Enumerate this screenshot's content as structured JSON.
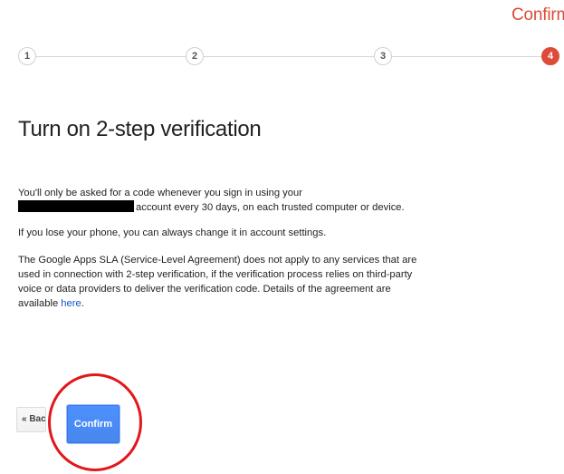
{
  "header": {
    "step_title": "Confirm"
  },
  "progress": {
    "steps": [
      "1",
      "2",
      "3",
      "4"
    ],
    "active_step": "4"
  },
  "main": {
    "heading": "Turn on 2-step verification",
    "paragraph_1_part_1": "You'll only be asked for a code whenever you sign in using your",
    "paragraph_1_part_2": "account every 30 days, on each trusted computer or device.",
    "paragraph_2": "If you lose your phone, you can always change it in account settings.",
    "paragraph_3_text": "The Google Apps SLA (Service-Level Agreement) does not apply to any services that are used in connection with 2-step verification, if the verification process relies on third-party voice or data providers to deliver the verification code. Details of the agreement are available",
    "here_link": "here",
    "period": "."
  },
  "actions": {
    "back_label": "« Back",
    "confirm_label": "Confirm"
  },
  "colors": {
    "accent_red": "#dd4b39",
    "button_blue": "#4d90fe",
    "link_blue": "#1155cc",
    "annotation_red": "#e2161b"
  }
}
